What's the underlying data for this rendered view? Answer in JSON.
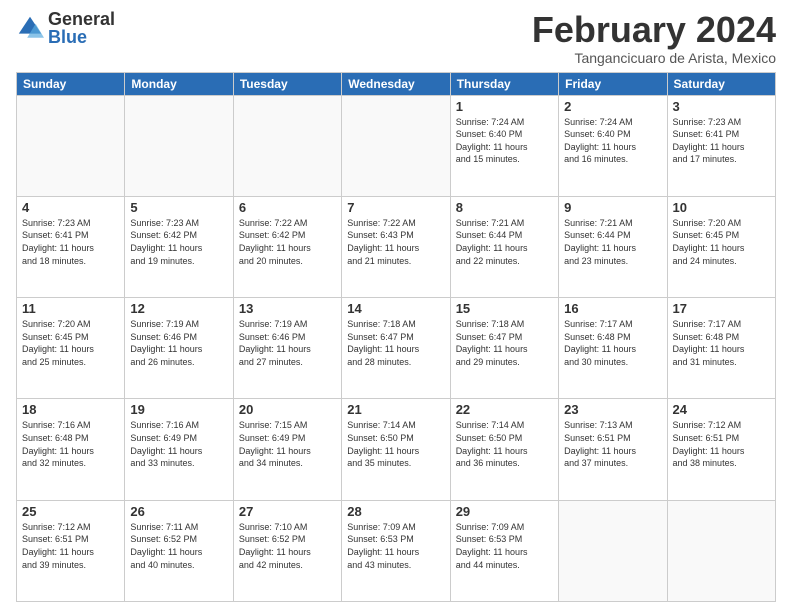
{
  "logo": {
    "general": "General",
    "blue": "Blue"
  },
  "header": {
    "month": "February 2024",
    "location": "Tangancicuaro de Arista, Mexico"
  },
  "weekdays": [
    "Sunday",
    "Monday",
    "Tuesday",
    "Wednesday",
    "Thursday",
    "Friday",
    "Saturday"
  ],
  "weeks": [
    [
      {
        "day": "",
        "info": ""
      },
      {
        "day": "",
        "info": ""
      },
      {
        "day": "",
        "info": ""
      },
      {
        "day": "",
        "info": ""
      },
      {
        "day": "1",
        "info": "Sunrise: 7:24 AM\nSunset: 6:40 PM\nDaylight: 11 hours\nand 15 minutes."
      },
      {
        "day": "2",
        "info": "Sunrise: 7:24 AM\nSunset: 6:40 PM\nDaylight: 11 hours\nand 16 minutes."
      },
      {
        "day": "3",
        "info": "Sunrise: 7:23 AM\nSunset: 6:41 PM\nDaylight: 11 hours\nand 17 minutes."
      }
    ],
    [
      {
        "day": "4",
        "info": "Sunrise: 7:23 AM\nSunset: 6:41 PM\nDaylight: 11 hours\nand 18 minutes."
      },
      {
        "day": "5",
        "info": "Sunrise: 7:23 AM\nSunset: 6:42 PM\nDaylight: 11 hours\nand 19 minutes."
      },
      {
        "day": "6",
        "info": "Sunrise: 7:22 AM\nSunset: 6:42 PM\nDaylight: 11 hours\nand 20 minutes."
      },
      {
        "day": "7",
        "info": "Sunrise: 7:22 AM\nSunset: 6:43 PM\nDaylight: 11 hours\nand 21 minutes."
      },
      {
        "day": "8",
        "info": "Sunrise: 7:21 AM\nSunset: 6:44 PM\nDaylight: 11 hours\nand 22 minutes."
      },
      {
        "day": "9",
        "info": "Sunrise: 7:21 AM\nSunset: 6:44 PM\nDaylight: 11 hours\nand 23 minutes."
      },
      {
        "day": "10",
        "info": "Sunrise: 7:20 AM\nSunset: 6:45 PM\nDaylight: 11 hours\nand 24 minutes."
      }
    ],
    [
      {
        "day": "11",
        "info": "Sunrise: 7:20 AM\nSunset: 6:45 PM\nDaylight: 11 hours\nand 25 minutes."
      },
      {
        "day": "12",
        "info": "Sunrise: 7:19 AM\nSunset: 6:46 PM\nDaylight: 11 hours\nand 26 minutes."
      },
      {
        "day": "13",
        "info": "Sunrise: 7:19 AM\nSunset: 6:46 PM\nDaylight: 11 hours\nand 27 minutes."
      },
      {
        "day": "14",
        "info": "Sunrise: 7:18 AM\nSunset: 6:47 PM\nDaylight: 11 hours\nand 28 minutes."
      },
      {
        "day": "15",
        "info": "Sunrise: 7:18 AM\nSunset: 6:47 PM\nDaylight: 11 hours\nand 29 minutes."
      },
      {
        "day": "16",
        "info": "Sunrise: 7:17 AM\nSunset: 6:48 PM\nDaylight: 11 hours\nand 30 minutes."
      },
      {
        "day": "17",
        "info": "Sunrise: 7:17 AM\nSunset: 6:48 PM\nDaylight: 11 hours\nand 31 minutes."
      }
    ],
    [
      {
        "day": "18",
        "info": "Sunrise: 7:16 AM\nSunset: 6:48 PM\nDaylight: 11 hours\nand 32 minutes."
      },
      {
        "day": "19",
        "info": "Sunrise: 7:16 AM\nSunset: 6:49 PM\nDaylight: 11 hours\nand 33 minutes."
      },
      {
        "day": "20",
        "info": "Sunrise: 7:15 AM\nSunset: 6:49 PM\nDaylight: 11 hours\nand 34 minutes."
      },
      {
        "day": "21",
        "info": "Sunrise: 7:14 AM\nSunset: 6:50 PM\nDaylight: 11 hours\nand 35 minutes."
      },
      {
        "day": "22",
        "info": "Sunrise: 7:14 AM\nSunset: 6:50 PM\nDaylight: 11 hours\nand 36 minutes."
      },
      {
        "day": "23",
        "info": "Sunrise: 7:13 AM\nSunset: 6:51 PM\nDaylight: 11 hours\nand 37 minutes."
      },
      {
        "day": "24",
        "info": "Sunrise: 7:12 AM\nSunset: 6:51 PM\nDaylight: 11 hours\nand 38 minutes."
      }
    ],
    [
      {
        "day": "25",
        "info": "Sunrise: 7:12 AM\nSunset: 6:51 PM\nDaylight: 11 hours\nand 39 minutes."
      },
      {
        "day": "26",
        "info": "Sunrise: 7:11 AM\nSunset: 6:52 PM\nDaylight: 11 hours\nand 40 minutes."
      },
      {
        "day": "27",
        "info": "Sunrise: 7:10 AM\nSunset: 6:52 PM\nDaylight: 11 hours\nand 42 minutes."
      },
      {
        "day": "28",
        "info": "Sunrise: 7:09 AM\nSunset: 6:53 PM\nDaylight: 11 hours\nand 43 minutes."
      },
      {
        "day": "29",
        "info": "Sunrise: 7:09 AM\nSunset: 6:53 PM\nDaylight: 11 hours\nand 44 minutes."
      },
      {
        "day": "",
        "info": ""
      },
      {
        "day": "",
        "info": ""
      }
    ]
  ]
}
